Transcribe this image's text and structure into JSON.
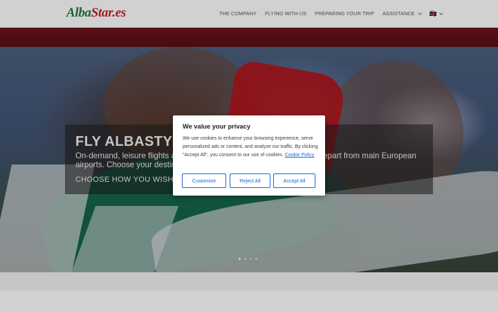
{
  "logo": {
    "part1": "Alba",
    "part2": "Star.es"
  },
  "nav": {
    "items": [
      "THE COMPANY",
      "FLYING WITH US",
      "PREPARING YOUR TRIP",
      "ASSISTANCE"
    ],
    "language_icon": "uk-flag-icon",
    "search_icon": "search-icon"
  },
  "hero": {
    "title": "FLY ALBASTYL",
    "text": "On-demand, leisure flights as w                                                        s depart from main European airports. Choose your destinati",
    "cta": "CHOOSE HOW YOU WISH TO F",
    "slide_count": 4,
    "active_slide": 1
  },
  "cookie": {
    "title": "We value your privacy",
    "text": "We use cookies to enhance your browsing experience, serve personalized ads or content, and analyze our traffic. By clicking \"Accept All\", you consent to our use of cookies.",
    "link": "Cookie Policy",
    "buttons": {
      "customize": "Customize",
      "reject": "Reject All",
      "accept": "Accept All"
    }
  },
  "colors": {
    "brand_green": "#1f7a3a",
    "brand_red": "#c8202b",
    "cookie_blue": "#1863dc"
  }
}
